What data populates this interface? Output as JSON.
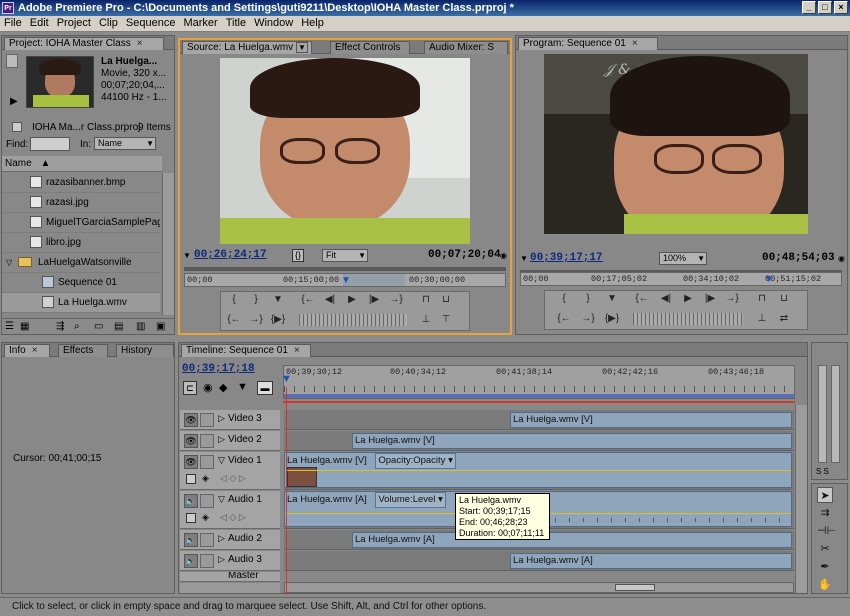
{
  "window": {
    "title": "Adobe Premiere Pro - C:\\Documents and Settings\\guti9211\\Desktop\\IOHA Master Class.prproj *",
    "app_icon": "Pr",
    "min": "_",
    "max": "□",
    "close": "×"
  },
  "menu": [
    "File",
    "Edit",
    "Project",
    "Clip",
    "Sequence",
    "Marker",
    "Title",
    "Window",
    "Help"
  ],
  "project": {
    "tab": "Project: IOHA Master Class",
    "clip_name": "La Huelga...",
    "clip_info1": "Movie, 320 x...",
    "clip_info2": "00;07;20;04,...",
    "clip_info3": "44100 Hz - 1...",
    "project_file": "IOHA Ma...r Class.prproj",
    "items_count": "9 Items",
    "find_label": "Find:",
    "in_label": "In:",
    "in_value": "Name",
    "col_name": "Name",
    "items": [
      "razasibanner.bmp",
      "razasi.jpg",
      "MiguelTGarciaSamplePages.j",
      "libro.jpg",
      "LaHuelgaWatsonville",
      "Sequence 01",
      "La Huelga.wmv"
    ]
  },
  "source": {
    "tabs": [
      "Source: La Huelga.wmv",
      "Effect Controls",
      "Audio Mixer: S"
    ],
    "tc_left": "00;26;24;17",
    "tc_right": "00;07;20;04",
    "fit": "Fit",
    "ruler": [
      "00;00",
      "00;15;00;00",
      "00;30;00;00"
    ],
    "playhead_fraction": 0.5
  },
  "program": {
    "tab": "Program: Sequence 01",
    "tc_left": "00;39;17;17",
    "tc_right": "00;48;54;03",
    "zoom": "100%",
    "ruler": [
      "00;00",
      "00;17;05;02",
      "00;34;10;02",
      "00;51;15;02"
    ],
    "playhead_fraction": 0.77
  },
  "info": {
    "tabs": [
      "Info",
      "Effects",
      "History"
    ],
    "cursor": "Cursor:  00;41;00;15"
  },
  "timeline": {
    "tab": "Timeline: Sequence 01",
    "tc": "00;39;17;18",
    "ruler": [
      "00;39;30;12",
      "00;40;34;12",
      "00;41;38;14",
      "00;42;42;16",
      "00;43;46;18"
    ],
    "tracks": [
      {
        "name": "Video 3",
        "clip": "La Huelga.wmv [V]"
      },
      {
        "name": "Video 2",
        "clip": "La Huelga.wmv [V]"
      },
      {
        "name": "Video 1",
        "clip": "La Huelga.wmv [V]",
        "fx": "Opacity:Opacity"
      },
      {
        "name": "Audio 1",
        "clip": "La Huelga.wmv [A]",
        "fx": "Volume:Level"
      },
      {
        "name": "Audio 2",
        "clip": "La Huelga.wmv [A]"
      },
      {
        "name": "Audio 3",
        "clip": "La Huelga.wmv [A]"
      },
      {
        "name": "Master"
      }
    ]
  },
  "tooltip": {
    "name": "La Huelga.wmv",
    "start": "Start: 00;39;17;15",
    "end": "End: 00;46;28;23",
    "duration": "Duration: 00;07;11;11"
  },
  "status": "Click to select, or click in empty space and drag to marquee select. Use Shift, Alt, and Ctrl for other options.",
  "colors": {
    "accent_border": "#e8a23c",
    "playhead": "#e03020",
    "clip": "#8fa5bb"
  }
}
